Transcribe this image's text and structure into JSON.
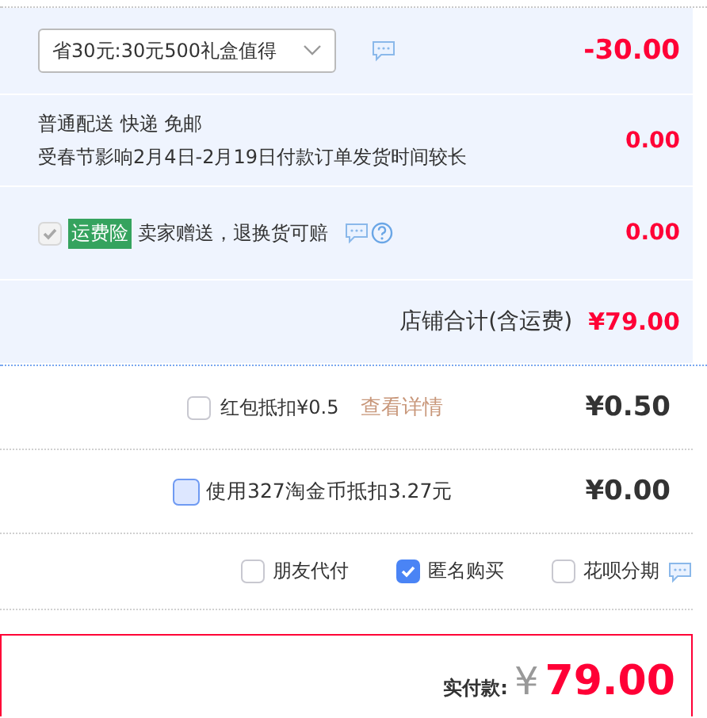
{
  "promo": {
    "select_value": "省30元:30元500礼盒值得",
    "amount": "-30.00"
  },
  "shipping": {
    "lines": [
      "普通配送 快递 免邮",
      "受春节影响2月4日-2月19日付款订单发货时间较长"
    ],
    "amount": "0.00"
  },
  "insurance": {
    "checked": true,
    "disabled": true,
    "tag": "运费险",
    "text": "卖家赠送，退换货可赔",
    "amount": "0.00"
  },
  "store_total": {
    "label": "店铺合计(含运费)",
    "amount": "¥79.00"
  },
  "red_envelope": {
    "checked": false,
    "label": "红包抵扣¥0.5",
    "link": "查看详情",
    "amount": "¥0.50"
  },
  "coins": {
    "checked": false,
    "focused": true,
    "label": "使用327淘金币抵扣3.27元",
    "amount": "¥0.00"
  },
  "options": [
    {
      "label": "朋友代付",
      "checked": false,
      "info": false
    },
    {
      "label": "匿名购买",
      "checked": true,
      "info": false
    },
    {
      "label": "花呗分期",
      "checked": false,
      "info": true
    }
  ],
  "payment": {
    "label": "实付款:",
    "currency": "¥",
    "amount": "79.00"
  }
}
